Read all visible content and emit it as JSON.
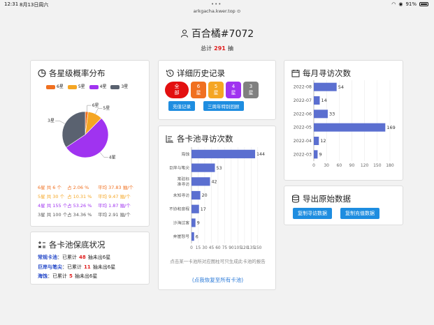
{
  "statusbar": {
    "time": "12:31",
    "date": "8月13日周六",
    "battery": "91%"
  },
  "url": "arkgacha.kwer.top",
  "header": {
    "title": "百合橘#7072",
    "total_prefix": "总计",
    "total": "291",
    "total_suffix": "抽"
  },
  "star_card": {
    "title": "各星级概率分布",
    "legend": [
      {
        "label": "6星",
        "color": "#f07020"
      },
      {
        "label": "5星",
        "color": "#f5a623"
      },
      {
        "label": "4星",
        "color": "#a033f0"
      },
      {
        "label": "3星",
        "color": "#5a6270"
      }
    ],
    "stats": [
      {
        "a": "6星 共 6 个",
        "b": "占 2.06 %",
        "c": "平均 37.83 抽/个",
        "color": "#f07020"
      },
      {
        "a": "5星 共 30 个",
        "b": "占 10.31 %",
        "c": "平均 9.47 抽/个",
        "color": "#f5a623"
      },
      {
        "a": "4星 共 155 个",
        "b": "占 53.26 %",
        "c": "平均 1.87 抽/个",
        "color": "#a033f0"
      },
      {
        "a": "3星 共 100 个",
        "b": "占 34.36 %",
        "c": "平均 2.91 抽/个",
        "color": "#555555"
      }
    ]
  },
  "guarantee_card": {
    "title": "各卡池保底状况",
    "rows": [
      {
        "name": "常规卡池",
        "pre": "已累计",
        "count": "48",
        "post": "抽未出6星"
      },
      {
        "name": "巨岸与笔尖",
        "pre": "已累计",
        "count": "11",
        "post": "抽未出6星"
      },
      {
        "name": "海蚀",
        "pre": "已累计",
        "count": "5",
        "post": "抽未出6星"
      }
    ]
  },
  "history_card": {
    "title": "详细历史记录",
    "star_buttons": [
      {
        "label": "全部",
        "color": "#e30f0f"
      },
      {
        "label": "6星",
        "color": "#f07020"
      },
      {
        "label": "5星",
        "color": "#f5a623"
      },
      {
        "label": "4星",
        "color": "#a033f0"
      },
      {
        "label": "3星",
        "color": "#808080"
      }
    ],
    "recharge_btn": "充值记录",
    "event_btn": "三周年特别回顾"
  },
  "pool_card": {
    "title": "各卡池寻访次数",
    "note": "点击某一卡池所对应图柱可只生成此卡池的报告",
    "reset_link": "(点我恢复至所有卡池)"
  },
  "month_card": {
    "title": "每月寻访次数"
  },
  "export_card": {
    "title": "导出原始数据",
    "btn_visits": "复制寻访数据",
    "btn_recharge": "复制充值数据"
  },
  "chart_data": [
    {
      "type": "pie",
      "title": "各星级概率分布",
      "labels": [
        "6星",
        "5星",
        "4星",
        "3星"
      ],
      "values": [
        6,
        30,
        155,
        100
      ],
      "colors": [
        "#f07020",
        "#f5a623",
        "#a033f0",
        "#5a6270"
      ]
    },
    {
      "type": "bar",
      "orientation": "horizontal",
      "title": "各卡池寻访次数",
      "categories": [
        "海蚀",
        "巨岸与笔尖",
        "常驻标准寻访",
        "未知寻访",
        "不协和音程",
        "沙海过客",
        "奔崖怒号"
      ],
      "category_lines": [
        [
          "海蚀"
        ],
        [
          "巨岸与笔尖"
        ],
        [
          "常驻标",
          "准寻访"
        ],
        [
          "未知寻访"
        ],
        [
          "不协和音程"
        ],
        [
          "沙海过客"
        ],
        [
          "奔崖怒号"
        ]
      ],
      "values": [
        144,
        53,
        42,
        20,
        17,
        9,
        6
      ],
      "xticks": [
        0,
        15,
        30,
        45,
        60,
        75,
        90,
        105,
        120,
        135,
        150
      ],
      "xlim": [
        0,
        155
      ],
      "color": "#5b6fd0"
    },
    {
      "type": "bar",
      "orientation": "horizontal",
      "title": "每月寻访次数",
      "categories": [
        "2022-08",
        "2022-07",
        "2022-06",
        "2022-05",
        "2022-04",
        "2022-03"
      ],
      "values": [
        54,
        14,
        33,
        169,
        12,
        9
      ],
      "xticks": [
        0,
        30,
        60,
        90,
        120,
        150,
        180
      ],
      "xlim": [
        0,
        185
      ],
      "color": "#5b6fd0"
    }
  ]
}
